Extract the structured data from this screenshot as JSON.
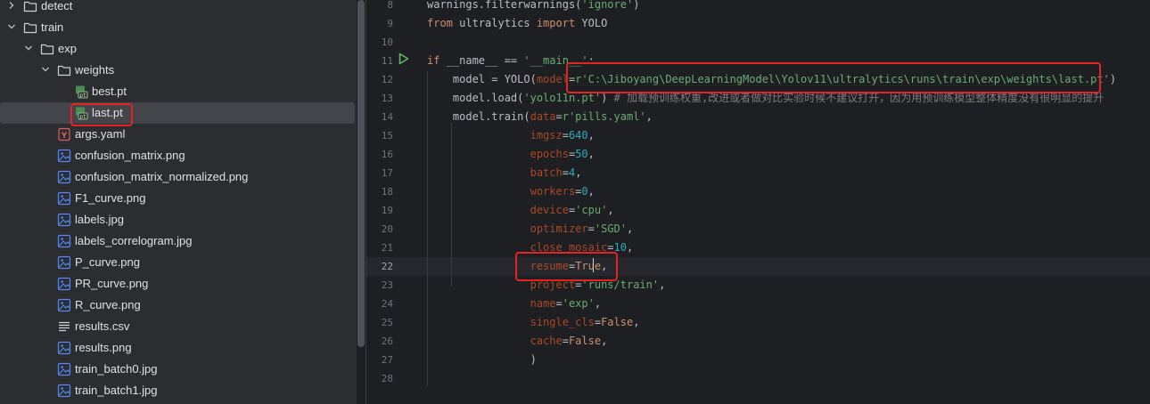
{
  "tree": {
    "items": [
      {
        "label": "detect",
        "icon": "folder-icon",
        "depth": 0,
        "chevron": "right"
      },
      {
        "label": "train",
        "icon": "folder-icon",
        "depth": 0,
        "chevron": "down"
      },
      {
        "label": "exp",
        "icon": "folder-icon",
        "depth": 1,
        "chevron": "down"
      },
      {
        "label": "weights",
        "icon": "folder-icon",
        "depth": 2,
        "chevron": "down"
      },
      {
        "label": "best.pt",
        "icon": "pt-file-icon",
        "depth": 3
      },
      {
        "label": "last.pt",
        "icon": "pt-file-icon",
        "depth": 3,
        "selected": true
      },
      {
        "label": "args.yaml",
        "icon": "yaml-file-icon",
        "depth": 2
      },
      {
        "label": "confusion_matrix.png",
        "icon": "image-file-icon",
        "depth": 2
      },
      {
        "label": "confusion_matrix_normalized.png",
        "icon": "image-file-icon",
        "depth": 2
      },
      {
        "label": "F1_curve.png",
        "icon": "image-file-icon",
        "depth": 2
      },
      {
        "label": "labels.jpg",
        "icon": "image-file-icon",
        "depth": 2
      },
      {
        "label": "labels_correlogram.jpg",
        "icon": "image-file-icon",
        "depth": 2
      },
      {
        "label": "P_curve.png",
        "icon": "image-file-icon",
        "depth": 2
      },
      {
        "label": "PR_curve.png",
        "icon": "image-file-icon",
        "depth": 2
      },
      {
        "label": "R_curve.png",
        "icon": "image-file-icon",
        "depth": 2
      },
      {
        "label": "results.csv",
        "icon": "text-file-icon",
        "depth": 2
      },
      {
        "label": "results.png",
        "icon": "image-file-icon",
        "depth": 2
      },
      {
        "label": "train_batch0.jpg",
        "icon": "image-file-icon",
        "depth": 2
      },
      {
        "label": "train_batch1.jpg",
        "icon": "image-file-icon",
        "depth": 2
      }
    ]
  },
  "editor": {
    "current_line": 22,
    "lines": [
      {
        "n": "8",
        "code": "warnings.filterwarnings('ignore')"
      },
      {
        "n": "9",
        "code": "from ultralytics import YOLO"
      },
      {
        "n": "10",
        "code": ""
      },
      {
        "n": "11",
        "code": "if __name__ == '__main__':"
      },
      {
        "n": "12",
        "code": "    model = YOLO(model=r'C:\\Jiboyang\\DeepLearningModel\\Yolov11\\ultralytics\\runs\\train\\exp\\weights\\last.pt')"
      },
      {
        "n": "13",
        "code": "    model.load('yolo11n.pt') # 加载预训练权重,改进或者做对比实验时候不建议打开，因为用预训练模型整体精度没有很明显的提升"
      },
      {
        "n": "14",
        "code": "    model.train(data=r'pills.yaml',"
      },
      {
        "n": "15",
        "code": "                imgsz=640,"
      },
      {
        "n": "16",
        "code": "                epochs=50,"
      },
      {
        "n": "17",
        "code": "                batch=4,"
      },
      {
        "n": "18",
        "code": "                workers=0,"
      },
      {
        "n": "19",
        "code": "                device='cpu',"
      },
      {
        "n": "20",
        "code": "                optimizer='SGD',"
      },
      {
        "n": "21",
        "code": "                close_mosaic=10,"
      },
      {
        "n": "22",
        "code": "                resume=True,"
      },
      {
        "n": "23",
        "code": "                project='runs/train',"
      },
      {
        "n": "24",
        "code": "                name='exp',"
      },
      {
        "n": "25",
        "code": "                single_cls=False,"
      },
      {
        "n": "26",
        "code": "                cache=False,"
      },
      {
        "n": "27",
        "code": "                )"
      },
      {
        "n": "28",
        "code": ""
      }
    ]
  },
  "colors": {
    "keyword": "#cf8e6d",
    "string": "#6aab73",
    "param": "#aa4926",
    "number": "#2aacb8",
    "comment": "#7a7e85",
    "highlight_box": "#e52323",
    "run_icon": "#5fb865"
  }
}
